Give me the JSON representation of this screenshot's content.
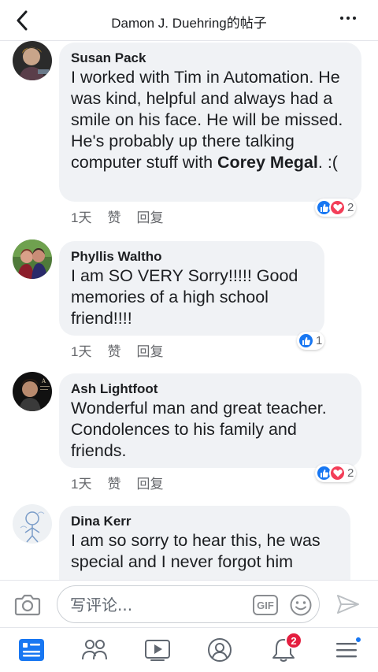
{
  "header": {
    "title": "Damon J. Duehring的帖子"
  },
  "comments": [
    {
      "author": "Susan Pack",
      "text_before": "I worked with Tim in Automation. He was kind, helpful and always had a smile on his face.  He will be missed.   He's probably up there talking computer stuff with ",
      "mention": "Corey Megal",
      "text_after": ".  :(",
      "time": "1天",
      "like_label": "赞",
      "reply_label": "回复",
      "reaction_count": "2",
      "reactions": [
        "like-icon",
        "love-icon"
      ]
    },
    {
      "author": "Phyllis Waltho",
      "text": "I am SO VERY Sorry!!!!!  Good memories of a high school friend!!!!",
      "time": "1天",
      "like_label": "赞",
      "reply_label": "回复",
      "reaction_count": "1",
      "reactions": [
        "like-icon"
      ]
    },
    {
      "author": "Ash Lightfoot",
      "text": "Wonderful man and great teacher. Condolences to his family and friends.",
      "time": "1天",
      "like_label": "赞",
      "reply_label": "回复",
      "reaction_count": "2",
      "reactions": [
        "like-icon",
        "love-icon"
      ]
    },
    {
      "author": "Dina Kerr",
      "text": "I am so sorry to hear this, he was special and I never forgot him"
    }
  ],
  "composer": {
    "placeholder": "写评论...",
    "gif_label": "GIF"
  },
  "tabbar": {
    "tabs": [
      "news-feed-icon",
      "friends-icon",
      "watch-icon",
      "profile-icon",
      "notifications-icon",
      "menu-icon"
    ],
    "notification_count": "2"
  },
  "colors": {
    "accent": "#1877f2",
    "love": "#f33e58",
    "bubble": "#f0f2f5",
    "badge": "#e41e3f"
  }
}
